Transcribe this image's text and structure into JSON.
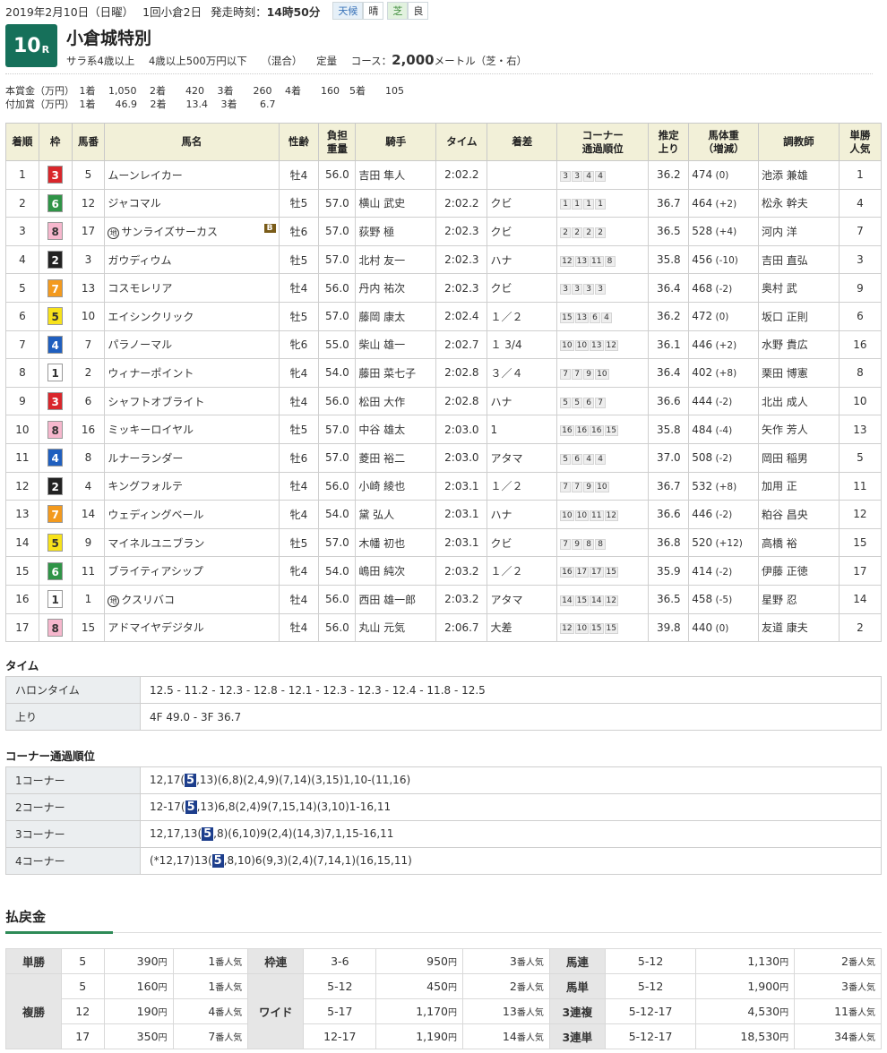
{
  "header": {
    "date": "2019年2月10日（日曜）",
    "meeting": "1回小倉2日",
    "start_label": "発走時刻：",
    "start_time": "14時50分",
    "weather_label": "天候",
    "weather": "晴",
    "surface_label": "芝",
    "condition": "良"
  },
  "race": {
    "number": "10",
    "suffix": "R",
    "name": "小倉城特別",
    "cond1": "サラ系4歳以上",
    "cond2": "4歳以上500万円以下",
    "cond3": "（混合）",
    "cond4": "定量",
    "course_label": "コース：",
    "course_dist": "2,000",
    "course_unit": "メートル（芝・右）"
  },
  "prize": {
    "line1": "本賞金（万円）　1着　 1,050　 2着　　420　 3着　　260　 4着　　160　5着　　105",
    "line2": "付加賞（万円）　1着　　46.9　 2着　　13.4　 3着　　 6.7"
  },
  "columns": [
    "着順",
    "枠",
    "馬番",
    "馬名",
    "性齢",
    "負担\n重量",
    "騎手",
    "タイム",
    "着差",
    "コーナー\n通過順位",
    "推定\n上り",
    "馬体重\n（増減）",
    "調教師",
    "単勝\n人気"
  ],
  "waku_colors": {
    "1": [
      "#ffffff",
      "#333"
    ],
    "2": [
      "#222222",
      "#fff"
    ],
    "3": [
      "#d9262b",
      "#fff"
    ],
    "4": [
      "#1f5fbf",
      "#fff"
    ],
    "5": [
      "#f7e21b",
      "#333"
    ],
    "6": [
      "#2f9447",
      "#fff"
    ],
    "7": [
      "#f39a1e",
      "#fff"
    ],
    "8": [
      "#f6b7cd",
      "#333"
    ]
  },
  "results": [
    {
      "pos": "1",
      "waku": "3",
      "num": "5",
      "name": "ムーンレイカー",
      "mark": "",
      "blinker": "",
      "sex": "牡4",
      "wt": "56.0",
      "jockey": "吉田 隼人",
      "time": "2:02.2",
      "margin": "",
      "corners": [
        "3",
        "3",
        "4",
        "4"
      ],
      "last": "36.2",
      "bw": "474",
      "bwd": "(0)",
      "trainer": "池添 兼雄",
      "pop": "1"
    },
    {
      "pos": "2",
      "waku": "6",
      "num": "12",
      "name": "ジャコマル",
      "mark": "",
      "blinker": "",
      "sex": "牡5",
      "wt": "57.0",
      "jockey": "横山 武史",
      "time": "2:02.2",
      "margin": "クビ",
      "corners": [
        "1",
        "1",
        "1",
        "1"
      ],
      "last": "36.7",
      "bw": "464",
      "bwd": "(+2)",
      "trainer": "松永 幹夫",
      "pop": "4"
    },
    {
      "pos": "3",
      "waku": "8",
      "num": "17",
      "name": "サンライズサーカス",
      "mark": "地",
      "blinker": "B",
      "sex": "牡6",
      "wt": "57.0",
      "jockey": "荻野 極",
      "time": "2:02.3",
      "margin": "クビ",
      "corners": [
        "2",
        "2",
        "2",
        "2"
      ],
      "last": "36.5",
      "bw": "528",
      "bwd": "(+4)",
      "trainer": "河内 洋",
      "pop": "7"
    },
    {
      "pos": "4",
      "waku": "2",
      "num": "3",
      "name": "ガウディウム",
      "mark": "",
      "blinker": "",
      "sex": "牡5",
      "wt": "57.0",
      "jockey": "北村 友一",
      "time": "2:02.3",
      "margin": "ハナ",
      "corners": [
        "12",
        "13",
        "11",
        "8"
      ],
      "last": "35.8",
      "bw": "456",
      "bwd": "(-10)",
      "trainer": "吉田 直弘",
      "pop": "3"
    },
    {
      "pos": "5",
      "waku": "7",
      "num": "13",
      "name": "コスモレリア",
      "mark": "",
      "blinker": "",
      "sex": "牡4",
      "wt": "56.0",
      "jockey": "丹内 祐次",
      "time": "2:02.3",
      "margin": "クビ",
      "corners": [
        "3",
        "3",
        "3",
        "3"
      ],
      "last": "36.4",
      "bw": "468",
      "bwd": "(-2)",
      "trainer": "奥村 武",
      "pop": "9"
    },
    {
      "pos": "6",
      "waku": "5",
      "num": "10",
      "name": "エイシンクリック",
      "mark": "",
      "blinker": "",
      "sex": "牡5",
      "wt": "57.0",
      "jockey": "藤岡 康太",
      "time": "2:02.4",
      "margin": "１／２",
      "corners": [
        "15",
        "13",
        "6",
        "4"
      ],
      "last": "36.2",
      "bw": "472",
      "bwd": "(0)",
      "trainer": "坂口 正則",
      "pop": "6"
    },
    {
      "pos": "7",
      "waku": "4",
      "num": "7",
      "name": "パラノーマル",
      "mark": "",
      "blinker": "",
      "sex": "牝6",
      "wt": "55.0",
      "jockey": "柴山 雄一",
      "time": "2:02.7",
      "margin": "１ 3/4",
      "corners": [
        "10",
        "10",
        "13",
        "12"
      ],
      "last": "36.1",
      "bw": "446",
      "bwd": "(+2)",
      "trainer": "水野 貴広",
      "pop": "16"
    },
    {
      "pos": "8",
      "waku": "1",
      "num": "2",
      "name": "ウィナーポイント",
      "mark": "",
      "blinker": "",
      "sex": "牝4",
      "wt": "54.0",
      "jockey": "藤田 菜七子",
      "time": "2:02.8",
      "margin": "３／４",
      "corners": [
        "7",
        "7",
        "9",
        "10"
      ],
      "last": "36.4",
      "bw": "402",
      "bwd": "(+8)",
      "trainer": "栗田 博憲",
      "pop": "8"
    },
    {
      "pos": "9",
      "waku": "3",
      "num": "6",
      "name": "シャフトオブライト",
      "mark": "",
      "blinker": "",
      "sex": "牡4",
      "wt": "56.0",
      "jockey": "松田 大作",
      "time": "2:02.8",
      "margin": "ハナ",
      "corners": [
        "5",
        "5",
        "6",
        "7"
      ],
      "last": "36.6",
      "bw": "444",
      "bwd": "(-2)",
      "trainer": "北出 成人",
      "pop": "10"
    },
    {
      "pos": "10",
      "waku": "8",
      "num": "16",
      "name": "ミッキーロイヤル",
      "mark": "",
      "blinker": "",
      "sex": "牡5",
      "wt": "57.0",
      "jockey": "中谷 雄太",
      "time": "2:03.0",
      "margin": "1",
      "corners": [
        "16",
        "16",
        "16",
        "15"
      ],
      "last": "35.8",
      "bw": "484",
      "bwd": "(-4)",
      "trainer": "矢作 芳人",
      "pop": "13"
    },
    {
      "pos": "11",
      "waku": "4",
      "num": "8",
      "name": "ルナーランダー",
      "mark": "",
      "blinker": "",
      "sex": "牡6",
      "wt": "57.0",
      "jockey": "菱田 裕二",
      "time": "2:03.0",
      "margin": "アタマ",
      "corners": [
        "5",
        "6",
        "4",
        "4"
      ],
      "last": "37.0",
      "bw": "508",
      "bwd": "(-2)",
      "trainer": "岡田 稲男",
      "pop": "5"
    },
    {
      "pos": "12",
      "waku": "2",
      "num": "4",
      "name": "キングフォルテ",
      "mark": "",
      "blinker": "",
      "sex": "牡4",
      "wt": "56.0",
      "jockey": "小崎 綾也",
      "time": "2:03.1",
      "margin": "１／２",
      "corners": [
        "7",
        "7",
        "9",
        "10"
      ],
      "last": "36.7",
      "bw": "532",
      "bwd": "(+8)",
      "trainer": "加用 正",
      "pop": "11"
    },
    {
      "pos": "13",
      "waku": "7",
      "num": "14",
      "name": "ウェディングベール",
      "mark": "",
      "blinker": "",
      "sex": "牝4",
      "wt": "54.0",
      "jockey": "黛 弘人",
      "time": "2:03.1",
      "margin": "ハナ",
      "corners": [
        "10",
        "10",
        "11",
        "12"
      ],
      "last": "36.6",
      "bw": "446",
      "bwd": "(-2)",
      "trainer": "粕谷 昌央",
      "pop": "12"
    },
    {
      "pos": "14",
      "waku": "5",
      "num": "9",
      "name": "マイネルユニブラン",
      "mark": "",
      "blinker": "",
      "sex": "牡5",
      "wt": "57.0",
      "jockey": "木幡 初也",
      "time": "2:03.1",
      "margin": "クビ",
      "corners": [
        "7",
        "9",
        "8",
        "8"
      ],
      "last": "36.8",
      "bw": "520",
      "bwd": "(+12)",
      "trainer": "高橋 裕",
      "pop": "15"
    },
    {
      "pos": "15",
      "waku": "6",
      "num": "11",
      "name": "ブライティアシップ",
      "mark": "",
      "blinker": "",
      "sex": "牝4",
      "wt": "54.0",
      "jockey": "嶋田 純次",
      "time": "2:03.2",
      "margin": "１／２",
      "corners": [
        "16",
        "17",
        "17",
        "15"
      ],
      "last": "35.9",
      "bw": "414",
      "bwd": "(-2)",
      "trainer": "伊藤 正徳",
      "pop": "17"
    },
    {
      "pos": "16",
      "waku": "1",
      "num": "1",
      "name": "クスリバコ",
      "mark": "地",
      "blinker": "",
      "sex": "牡4",
      "wt": "56.0",
      "jockey": "西田 雄一郎",
      "time": "2:03.2",
      "margin": "アタマ",
      "corners": [
        "14",
        "15",
        "14",
        "12"
      ],
      "last": "36.5",
      "bw": "458",
      "bwd": "(-5)",
      "trainer": "星野 忍",
      "pop": "14"
    },
    {
      "pos": "17",
      "waku": "8",
      "num": "15",
      "name": "アドマイヤデジタル",
      "mark": "",
      "blinker": "",
      "sex": "牡4",
      "wt": "56.0",
      "jockey": "丸山 元気",
      "time": "2:06.7",
      "margin": "大差",
      "corners": [
        "12",
        "10",
        "15",
        "15"
      ],
      "last": "39.8",
      "bw": "440",
      "bwd": "(0)",
      "trainer": "友道 康夫",
      "pop": "2"
    }
  ],
  "time_section": {
    "title": "タイム",
    "furlong_label": "ハロンタイム",
    "furlong": "12.5 - 11.2 - 12.3 - 12.8 - 12.1 - 12.3 - 12.3 - 12.4 - 11.8 - 12.5",
    "last_label": "上り",
    "last": "4F 49.0 - 3F 36.7"
  },
  "corner_section": {
    "title": "コーナー通過順位",
    "rows": [
      {
        "label": "1コーナー",
        "pre": "12,17(",
        "hl": "5",
        "post": ",13)(6,8)(2,4,9)(7,14)(3,15)1,10-(11,16)"
      },
      {
        "label": "2コーナー",
        "pre": "12-17(",
        "hl": "5",
        "post": ",13)6,8(2,4)9(7,15,14)(3,10)1-16,11"
      },
      {
        "label": "3コーナー",
        "pre": "12,17,13(",
        "hl": "5",
        "post": ",8)(6,10)9(2,4)(14,3)7,1,15-16,11"
      },
      {
        "label": "4コーナー",
        "pre": "(*12,17)13(",
        "hl": "5",
        "post": ",8,10)6(9,3)(2,4)(7,14,1)(16,15,11)"
      }
    ]
  },
  "payout": {
    "title": "払戻金",
    "unit": "円",
    "pop_suffix": "番人気",
    "tansho": {
      "label": "単勝",
      "rows": [
        {
          "num": "5",
          "amt": "390",
          "pop": "1"
        }
      ]
    },
    "fukusho": {
      "label": "複勝",
      "rows": [
        {
          "num": "5",
          "amt": "160",
          "pop": "1"
        },
        {
          "num": "12",
          "amt": "190",
          "pop": "4"
        },
        {
          "num": "17",
          "amt": "350",
          "pop": "7"
        }
      ]
    },
    "wakuren": {
      "label": "枠連",
      "rows": [
        {
          "num": "3-6",
          "amt": "950",
          "pop": "3"
        }
      ]
    },
    "wide": {
      "label": "ワイド",
      "rows": [
        {
          "num": "5-12",
          "amt": "450",
          "pop": "2"
        },
        {
          "num": "5-17",
          "amt": "1,170",
          "pop": "13"
        },
        {
          "num": "12-17",
          "amt": "1,190",
          "pop": "14"
        }
      ]
    },
    "umaren": {
      "label": "馬連",
      "num": "5-12",
      "amt": "1,130",
      "pop": "2"
    },
    "umatan": {
      "label": "馬単",
      "num": "5-12",
      "amt": "1,900",
      "pop": "3"
    },
    "sanfuku": {
      "label": "3連複",
      "num": "5-12-17",
      "amt": "4,530",
      "pop": "11"
    },
    "santan": {
      "label": "3連単",
      "num": "5-12-17",
      "amt": "18,530",
      "pop": "34"
    }
  }
}
